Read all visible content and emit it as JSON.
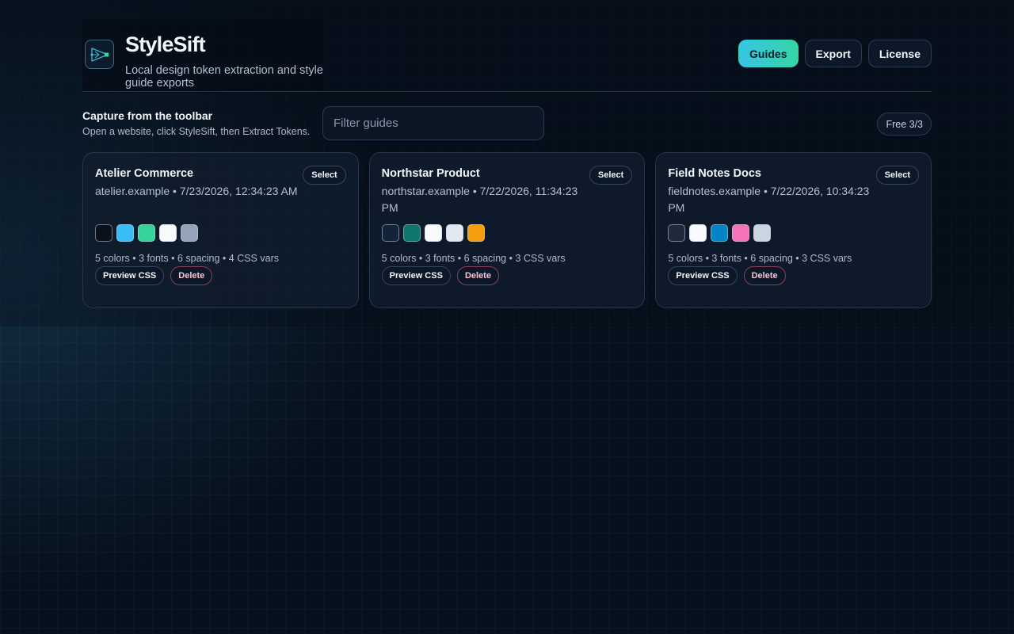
{
  "app": {
    "title": "StyleSift",
    "subtitle": "Local design token extraction and style guide exports",
    "logo_icon": "token-tree-icon"
  },
  "nav": {
    "items": [
      {
        "label": "Guides",
        "active": true
      },
      {
        "label": "Export",
        "active": false
      },
      {
        "label": "License",
        "active": false
      }
    ]
  },
  "capture": {
    "title": "Capture from the toolbar",
    "description": "Open a website, click StyleSift, then Extract Tokens."
  },
  "filter": {
    "placeholder": "Filter guides",
    "value": ""
  },
  "plan_badge": "Free 3/3",
  "actions": {
    "select": "Select",
    "preview": "Preview CSS",
    "delete": "Delete"
  },
  "guides": [
    {
      "title": "Atelier Commerce",
      "meta": "atelier.example • 7/23/2026, 12:34:23 AM",
      "swatches": [
        "#0a101c",
        "#38bdf8",
        "#34d399",
        "#f8fafc",
        "#94a3b8"
      ],
      "stats": "5 colors • 3 fonts • 6 spacing • 4 CSS vars"
    },
    {
      "title": "Northstar Product",
      "meta": "northstar.example • 7/22/2026, 11:34:23 PM",
      "swatches": [
        "#13233a",
        "#0f766e",
        "#f8fafc",
        "#e2e8f0",
        "#f59e0b"
      ],
      "stats": "5 colors • 3 fonts • 6 spacing • 3 CSS vars"
    },
    {
      "title": "Field Notes Docs",
      "meta": "fieldnotes.example • 7/22/2026, 10:34:23 PM",
      "swatches": [
        "#1e293b",
        "#f8fafc",
        "#0284c7",
        "#f472b6",
        "#cbd5e1"
      ],
      "stats": "5 colors • 3 fonts • 6 spacing • 3 CSS vars"
    }
  ],
  "colors": {
    "accent_start": "#38c4e6",
    "accent_end": "#35d5a5",
    "danger": "#8e3d5c",
    "background": "#06111d"
  }
}
